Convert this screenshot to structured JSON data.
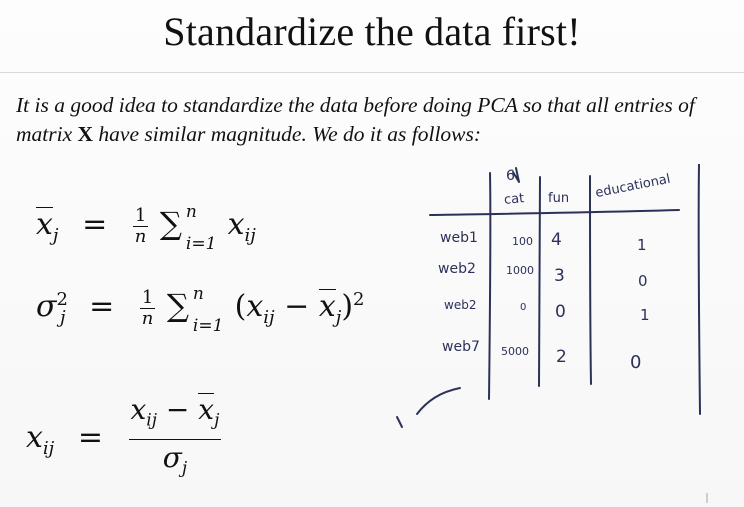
{
  "slide": {
    "title": "Standardize the data first!",
    "intro": {
      "part1": "It is a good idea to standardize the data before doing PCA so that all entries of matrix ",
      "matrix_symbol": "X",
      "part2": " have similar magnitude. We do it as follows:"
    }
  },
  "formulas": [
    {
      "id": "mean",
      "lhs": "x̄_j",
      "rhs": "(1/n) Σ_{i=1}^{n} x_ij"
    },
    {
      "id": "variance",
      "lhs": "σ_j²",
      "rhs": "(1/n) Σ_{i=1}^{n} (x_ij − x̄_j)²"
    },
    {
      "id": "standardized",
      "lhs": "x_ij",
      "rhs": "(x_ij − x̄_j) / σ_j"
    }
  ],
  "annotation": {
    "columns": [
      "cat",
      "fun",
      "educational"
    ],
    "rows": [
      {
        "label": "web1",
        "values": [
          "100",
          "4",
          "1"
        ]
      },
      {
        "label": "web2",
        "values": [
          "1000",
          "3",
          "0"
        ]
      },
      {
        "label": "web2",
        "values": [
          "0",
          "0",
          "1"
        ]
      },
      {
        "label": "web7",
        "values": [
          "5000",
          "2",
          "0"
        ]
      }
    ],
    "marker": "6"
  },
  "colors": {
    "ink": "#111111",
    "handwriting": "#2c3159",
    "background": "#fbfbfb"
  }
}
